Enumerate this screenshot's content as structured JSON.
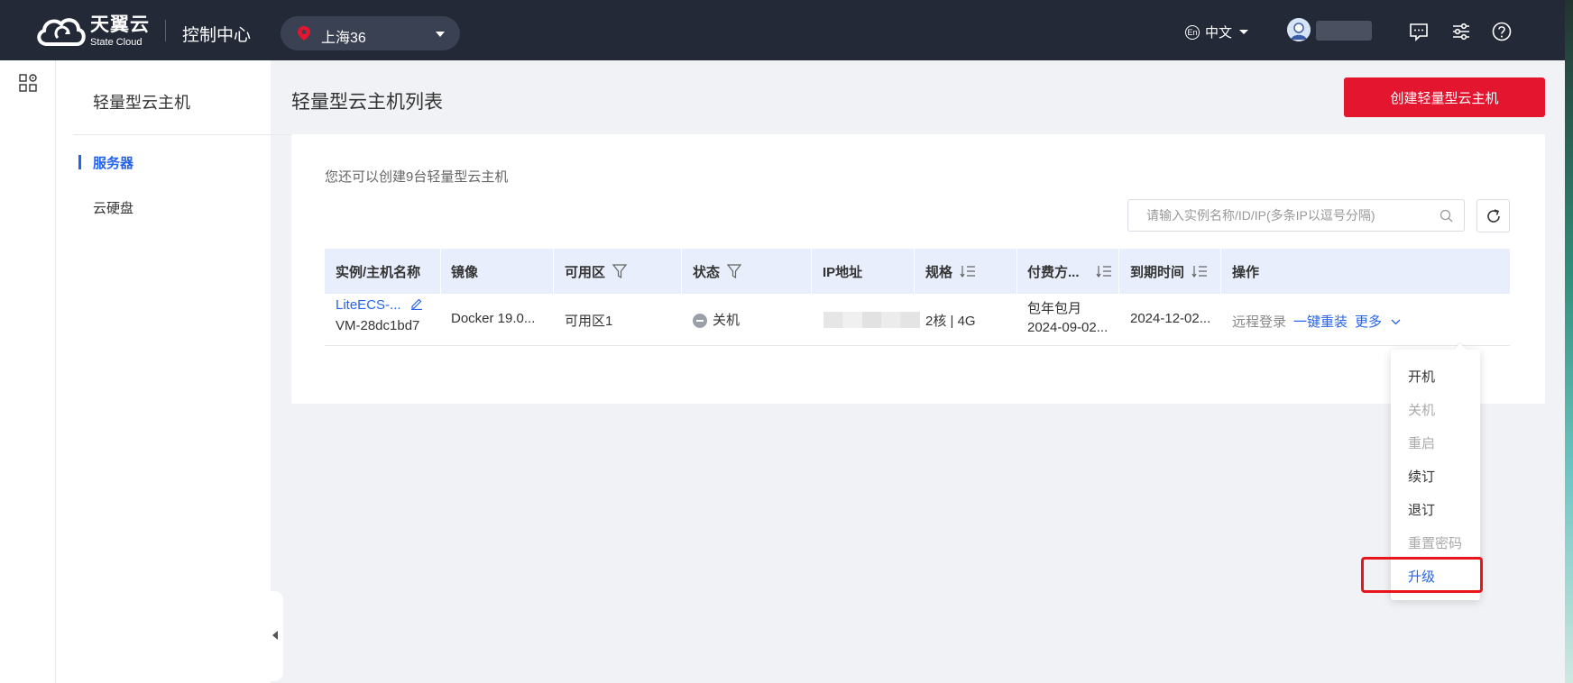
{
  "header": {
    "brand_cn": "天翼云",
    "brand_en": "State Cloud",
    "console_title": "控制中心",
    "region": "上海36",
    "language": "中文",
    "lang_badge": "En"
  },
  "sidebar": {
    "title": "轻量型云主机",
    "items": [
      {
        "label": "服务器",
        "active": true
      },
      {
        "label": "云硬盘",
        "active": false
      }
    ]
  },
  "main": {
    "page_title": "轻量型云主机列表",
    "create_button": "创建轻量型云主机",
    "quota_text": "您还可以创建9台轻量型云主机",
    "search_placeholder": "请输入实例名称/ID/IP(多条IP以逗号分隔)",
    "table": {
      "headers": [
        "实例/主机名称",
        "镜像",
        "可用区",
        "状态",
        "IP地址",
        "规格",
        "付费方...",
        "到期时间",
        "操作"
      ],
      "rows": [
        {
          "name": "LiteECS-...",
          "host": "VM-28dc1bd7",
          "image": "Docker 19.0...",
          "zone": "可用区1",
          "status": "关机",
          "spec": "2核 | 4G",
          "billing": "包年包月",
          "billing_date": "2024-09-02...",
          "expire": "2024-12-02...",
          "actions": [
            "远程登录",
            "一键重装",
            "更多"
          ]
        }
      ]
    }
  },
  "more_menu": {
    "items": [
      {
        "label": "开机",
        "disabled": false
      },
      {
        "label": "关机",
        "disabled": true
      },
      {
        "label": "重启",
        "disabled": true
      },
      {
        "label": "续订",
        "disabled": false
      },
      {
        "label": "退订",
        "disabled": false
      },
      {
        "label": "重置密码",
        "disabled": true
      },
      {
        "label": "升级",
        "disabled": false,
        "highlighted": true
      }
    ]
  },
  "colors": {
    "topbar": "#232936",
    "accent": "#2563eb",
    "brand_red": "#e3152f",
    "highlight_box": "#e8151b"
  }
}
